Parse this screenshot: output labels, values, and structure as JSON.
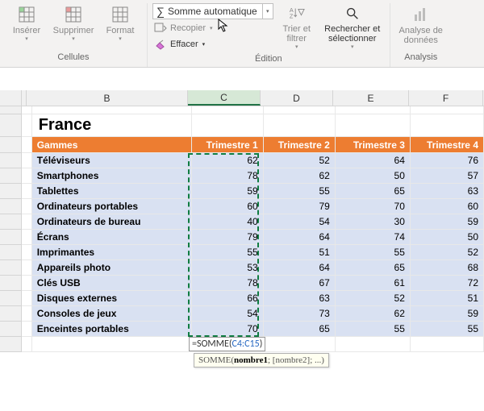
{
  "ribbon": {
    "groups": {
      "cells": {
        "label": "Cellules",
        "insert": "Insérer",
        "delete": "Supprimer",
        "format": "Format"
      },
      "editing": {
        "label": "Édition",
        "autosum": "Somme automatique",
        "fill": "Recopier",
        "clear": "Effacer",
        "sort": "Trier et filtrer",
        "find": "Rechercher et sélectionner"
      },
      "analysis": {
        "label": "Analysis",
        "analyze": "Analyse de données"
      }
    }
  },
  "columns": [
    "B",
    "C",
    "D",
    "E",
    "F"
  ],
  "title": "France",
  "headers": [
    "Gammes",
    "Trimestre 1",
    "Trimestre 2",
    "Trimestre 3",
    "Trimestre 4"
  ],
  "rows": [
    {
      "g": "Téléviseurs",
      "v": [
        62,
        52,
        64,
        76
      ]
    },
    {
      "g": "Smartphones",
      "v": [
        78,
        62,
        50,
        57
      ]
    },
    {
      "g": "Tablettes",
      "v": [
        59,
        55,
        65,
        63
      ]
    },
    {
      "g": "Ordinateurs portables",
      "v": [
        60,
        79,
        70,
        60
      ]
    },
    {
      "g": "Ordinateurs de bureau",
      "v": [
        40,
        54,
        30,
        59
      ]
    },
    {
      "g": "Écrans",
      "v": [
        79,
        64,
        74,
        50
      ]
    },
    {
      "g": "Imprimantes",
      "v": [
        55,
        51,
        55,
        52
      ]
    },
    {
      "g": "Appareils photo",
      "v": [
        53,
        64,
        65,
        68
      ]
    },
    {
      "g": "Clés USB",
      "v": [
        78,
        67,
        61,
        72
      ]
    },
    {
      "g": "Disques externes",
      "v": [
        66,
        63,
        52,
        51
      ]
    },
    {
      "g": "Consoles de jeux",
      "v": [
        54,
        73,
        62,
        59
      ]
    },
    {
      "g": "Enceintes portables",
      "v": [
        70,
        65,
        55,
        55
      ]
    }
  ],
  "formula": {
    "prefix": "=SOMME(",
    "ref": "C4:C15",
    "suffix": ")"
  },
  "hint": {
    "fn": "SOMME(",
    "arg1": "nombre1",
    "rest": "; [nombre2]; ...)"
  }
}
